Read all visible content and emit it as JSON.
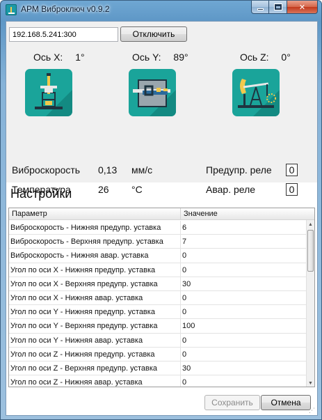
{
  "window": {
    "title": "АРМ Виброключ v0.9.2"
  },
  "connection": {
    "address": "192.168.5.241:300",
    "disconnect_label": "Отключить"
  },
  "axes": [
    {
      "label": "Ось X:",
      "value": "1°",
      "icon": "pump-jack-front-icon"
    },
    {
      "label": "Ось Y:",
      "value": "89°",
      "icon": "pump-jack-top-icon"
    },
    {
      "label": "Ось Z:",
      "value": "0°",
      "icon": "pump-jack-side-icon"
    }
  ],
  "measurements": {
    "vibration_label": "Виброскорость",
    "vibration_value": "0,13",
    "vibration_unit": "мм/с",
    "temperature_label": "Температура",
    "temperature_value": "26",
    "temperature_unit": "°C"
  },
  "relays": {
    "warning_label": "Предупр. реле",
    "warning_value": "0",
    "alarm_label": "Авар. реле",
    "alarm_value": "0"
  },
  "settings": {
    "title": "Настройки",
    "columns": [
      "Параметр",
      "Значение"
    ],
    "rows": [
      {
        "param": "Виброскорость - Нижняя предупр. уставка",
        "value": "6"
      },
      {
        "param": "Виброскорость - Верхняя предупр. уставка",
        "value": "7"
      },
      {
        "param": "Виброскорость - Нижняя авар. уставка",
        "value": "0"
      },
      {
        "param": "Угол по оси X - Нижняя предупр. уставка",
        "value": "0"
      },
      {
        "param": "Угол по оси X - Верхняя предупр. уставка",
        "value": "30"
      },
      {
        "param": "Угол по оси X - Нижняя авар. уставка",
        "value": "0"
      },
      {
        "param": "Угол по оси Y - Нижняя предупр. уставка",
        "value": "0"
      },
      {
        "param": "Угол по оси Y - Верхняя предупр. уставка",
        "value": "100"
      },
      {
        "param": "Угол по оси Y - Нижняя авар. уставка",
        "value": "0"
      },
      {
        "param": "Угол по оси Z - Нижняя предупр. уставка",
        "value": "0"
      },
      {
        "param": "Угол по оси Z - Верхняя предупр. уставка",
        "value": "30"
      },
      {
        "param": "Угол по оси Z - Нижняя авар. уставка",
        "value": "0"
      }
    ]
  },
  "footer": {
    "save_label": "Сохранить",
    "cancel_label": "Отмена"
  },
  "colors": {
    "tile": "#1aa49a",
    "titlebar": "#6fa7d3"
  }
}
